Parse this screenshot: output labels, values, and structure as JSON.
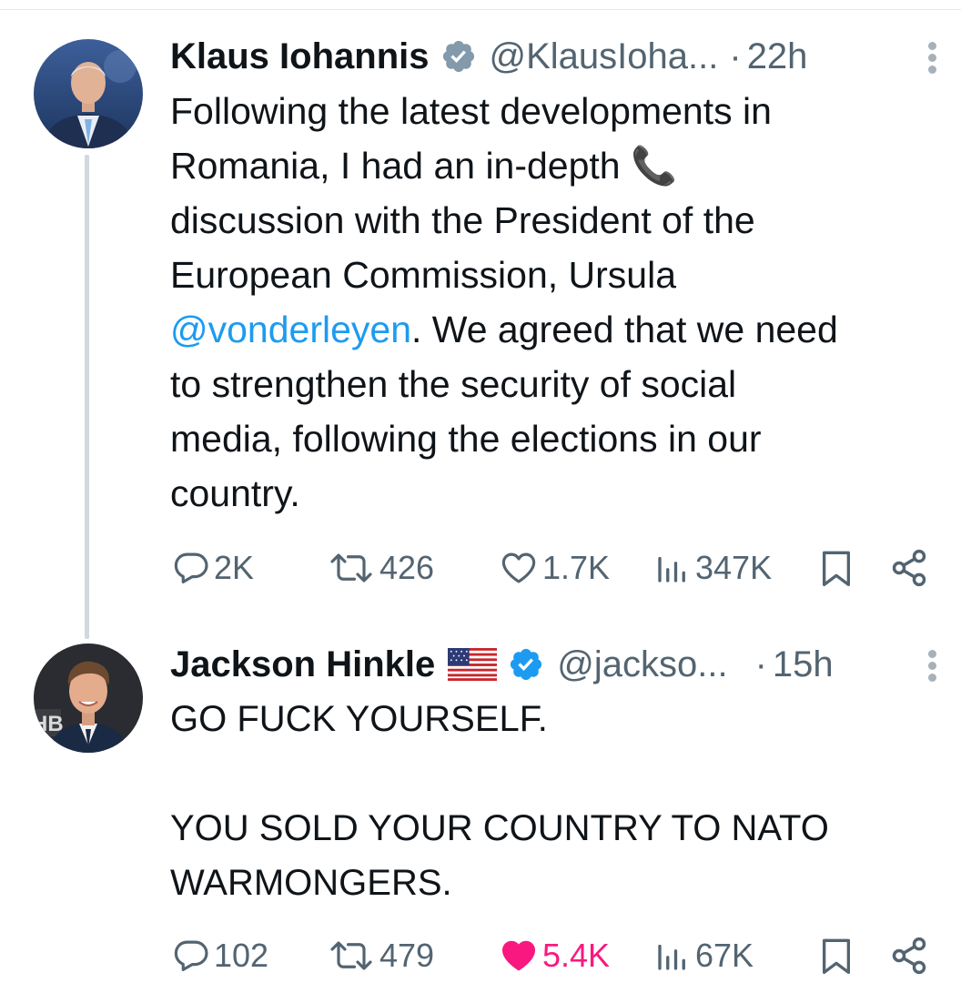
{
  "tweets": [
    {
      "name": "Klaus Iohannis",
      "handle": "@KlausIoha...",
      "dot": "·",
      "time": "22h",
      "text_before": "Following the latest developments in\nRomania, I had an in-depth 📞\ndiscussion with the President of the\nEuropean Commission, Ursula\n",
      "mention": "@vonderleyen",
      "text_after": ". We agreed that we need\nto strengthen the security of social\nmedia, following the elections in our\ncountry.",
      "replies": "2K",
      "reposts": "426",
      "likes": "1.7K",
      "views": "347K",
      "liked": false
    },
    {
      "name": "Jackson Hinkle",
      "handle": "@jackso...",
      "dot": "·",
      "time": "15h",
      "text": "GO FUCK YOURSELF.\n\nYOU SOLD YOUR COUNTRY TO NATO\nWARMONGERS.",
      "avatar_badge": "HB",
      "replies": "102",
      "reposts": "479",
      "likes": "5.4K",
      "views": "67K",
      "liked": true
    }
  ],
  "colors": {
    "text": "#0f1419",
    "secondary": "#536471",
    "accent": "#1d9bf0",
    "like": "#f91880",
    "thread_line": "#cfd9de"
  },
  "icons": {
    "verified": "verified-badge-icon",
    "flag": "us-flag-icon",
    "reply": "reply-bubble-icon",
    "repost": "repost-arrows-icon",
    "like": "heart-icon",
    "views": "bar-chart-icon",
    "bookmark": "bookmark-icon",
    "share": "share-icon",
    "more": "more-vertical-icon"
  }
}
